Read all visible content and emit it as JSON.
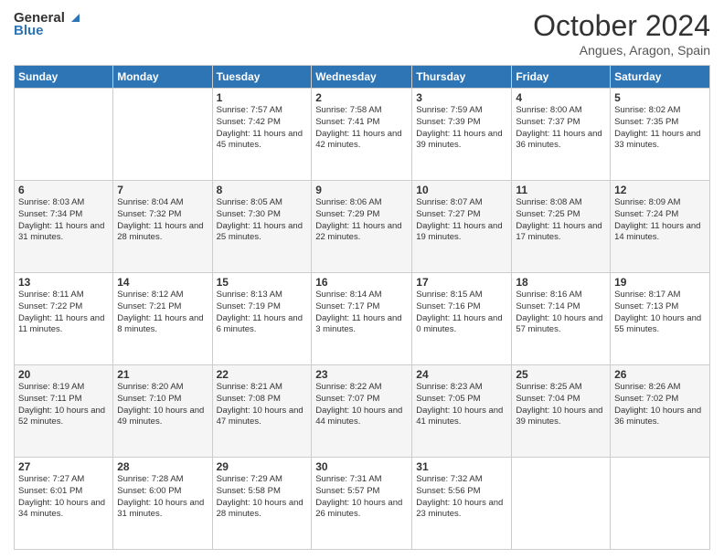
{
  "header": {
    "logo": {
      "line1": "General",
      "line2": "Blue"
    },
    "title": "October 2024",
    "location": "Angues, Aragon, Spain"
  },
  "weekdays": [
    "Sunday",
    "Monday",
    "Tuesday",
    "Wednesday",
    "Thursday",
    "Friday",
    "Saturday"
  ],
  "weeks": [
    [
      {
        "day": "",
        "info": ""
      },
      {
        "day": "",
        "info": ""
      },
      {
        "day": "1",
        "info": "Sunrise: 7:57 AM\nSunset: 7:42 PM\nDaylight: 11 hours and 45 minutes."
      },
      {
        "day": "2",
        "info": "Sunrise: 7:58 AM\nSunset: 7:41 PM\nDaylight: 11 hours and 42 minutes."
      },
      {
        "day": "3",
        "info": "Sunrise: 7:59 AM\nSunset: 7:39 PM\nDaylight: 11 hours and 39 minutes."
      },
      {
        "day": "4",
        "info": "Sunrise: 8:00 AM\nSunset: 7:37 PM\nDaylight: 11 hours and 36 minutes."
      },
      {
        "day": "5",
        "info": "Sunrise: 8:02 AM\nSunset: 7:35 PM\nDaylight: 11 hours and 33 minutes."
      }
    ],
    [
      {
        "day": "6",
        "info": "Sunrise: 8:03 AM\nSunset: 7:34 PM\nDaylight: 11 hours and 31 minutes."
      },
      {
        "day": "7",
        "info": "Sunrise: 8:04 AM\nSunset: 7:32 PM\nDaylight: 11 hours and 28 minutes."
      },
      {
        "day": "8",
        "info": "Sunrise: 8:05 AM\nSunset: 7:30 PM\nDaylight: 11 hours and 25 minutes."
      },
      {
        "day": "9",
        "info": "Sunrise: 8:06 AM\nSunset: 7:29 PM\nDaylight: 11 hours and 22 minutes."
      },
      {
        "day": "10",
        "info": "Sunrise: 8:07 AM\nSunset: 7:27 PM\nDaylight: 11 hours and 19 minutes."
      },
      {
        "day": "11",
        "info": "Sunrise: 8:08 AM\nSunset: 7:25 PM\nDaylight: 11 hours and 17 minutes."
      },
      {
        "day": "12",
        "info": "Sunrise: 8:09 AM\nSunset: 7:24 PM\nDaylight: 11 hours and 14 minutes."
      }
    ],
    [
      {
        "day": "13",
        "info": "Sunrise: 8:11 AM\nSunset: 7:22 PM\nDaylight: 11 hours and 11 minutes."
      },
      {
        "day": "14",
        "info": "Sunrise: 8:12 AM\nSunset: 7:21 PM\nDaylight: 11 hours and 8 minutes."
      },
      {
        "day": "15",
        "info": "Sunrise: 8:13 AM\nSunset: 7:19 PM\nDaylight: 11 hours and 6 minutes."
      },
      {
        "day": "16",
        "info": "Sunrise: 8:14 AM\nSunset: 7:17 PM\nDaylight: 11 hours and 3 minutes."
      },
      {
        "day": "17",
        "info": "Sunrise: 8:15 AM\nSunset: 7:16 PM\nDaylight: 11 hours and 0 minutes."
      },
      {
        "day": "18",
        "info": "Sunrise: 8:16 AM\nSunset: 7:14 PM\nDaylight: 10 hours and 57 minutes."
      },
      {
        "day": "19",
        "info": "Sunrise: 8:17 AM\nSunset: 7:13 PM\nDaylight: 10 hours and 55 minutes."
      }
    ],
    [
      {
        "day": "20",
        "info": "Sunrise: 8:19 AM\nSunset: 7:11 PM\nDaylight: 10 hours and 52 minutes."
      },
      {
        "day": "21",
        "info": "Sunrise: 8:20 AM\nSunset: 7:10 PM\nDaylight: 10 hours and 49 minutes."
      },
      {
        "day": "22",
        "info": "Sunrise: 8:21 AM\nSunset: 7:08 PM\nDaylight: 10 hours and 47 minutes."
      },
      {
        "day": "23",
        "info": "Sunrise: 8:22 AM\nSunset: 7:07 PM\nDaylight: 10 hours and 44 minutes."
      },
      {
        "day": "24",
        "info": "Sunrise: 8:23 AM\nSunset: 7:05 PM\nDaylight: 10 hours and 41 minutes."
      },
      {
        "day": "25",
        "info": "Sunrise: 8:25 AM\nSunset: 7:04 PM\nDaylight: 10 hours and 39 minutes."
      },
      {
        "day": "26",
        "info": "Sunrise: 8:26 AM\nSunset: 7:02 PM\nDaylight: 10 hours and 36 minutes."
      }
    ],
    [
      {
        "day": "27",
        "info": "Sunrise: 7:27 AM\nSunset: 6:01 PM\nDaylight: 10 hours and 34 minutes."
      },
      {
        "day": "28",
        "info": "Sunrise: 7:28 AM\nSunset: 6:00 PM\nDaylight: 10 hours and 31 minutes."
      },
      {
        "day": "29",
        "info": "Sunrise: 7:29 AM\nSunset: 5:58 PM\nDaylight: 10 hours and 28 minutes."
      },
      {
        "day": "30",
        "info": "Sunrise: 7:31 AM\nSunset: 5:57 PM\nDaylight: 10 hours and 26 minutes."
      },
      {
        "day": "31",
        "info": "Sunrise: 7:32 AM\nSunset: 5:56 PM\nDaylight: 10 hours and 23 minutes."
      },
      {
        "day": "",
        "info": ""
      },
      {
        "day": "",
        "info": ""
      }
    ]
  ]
}
